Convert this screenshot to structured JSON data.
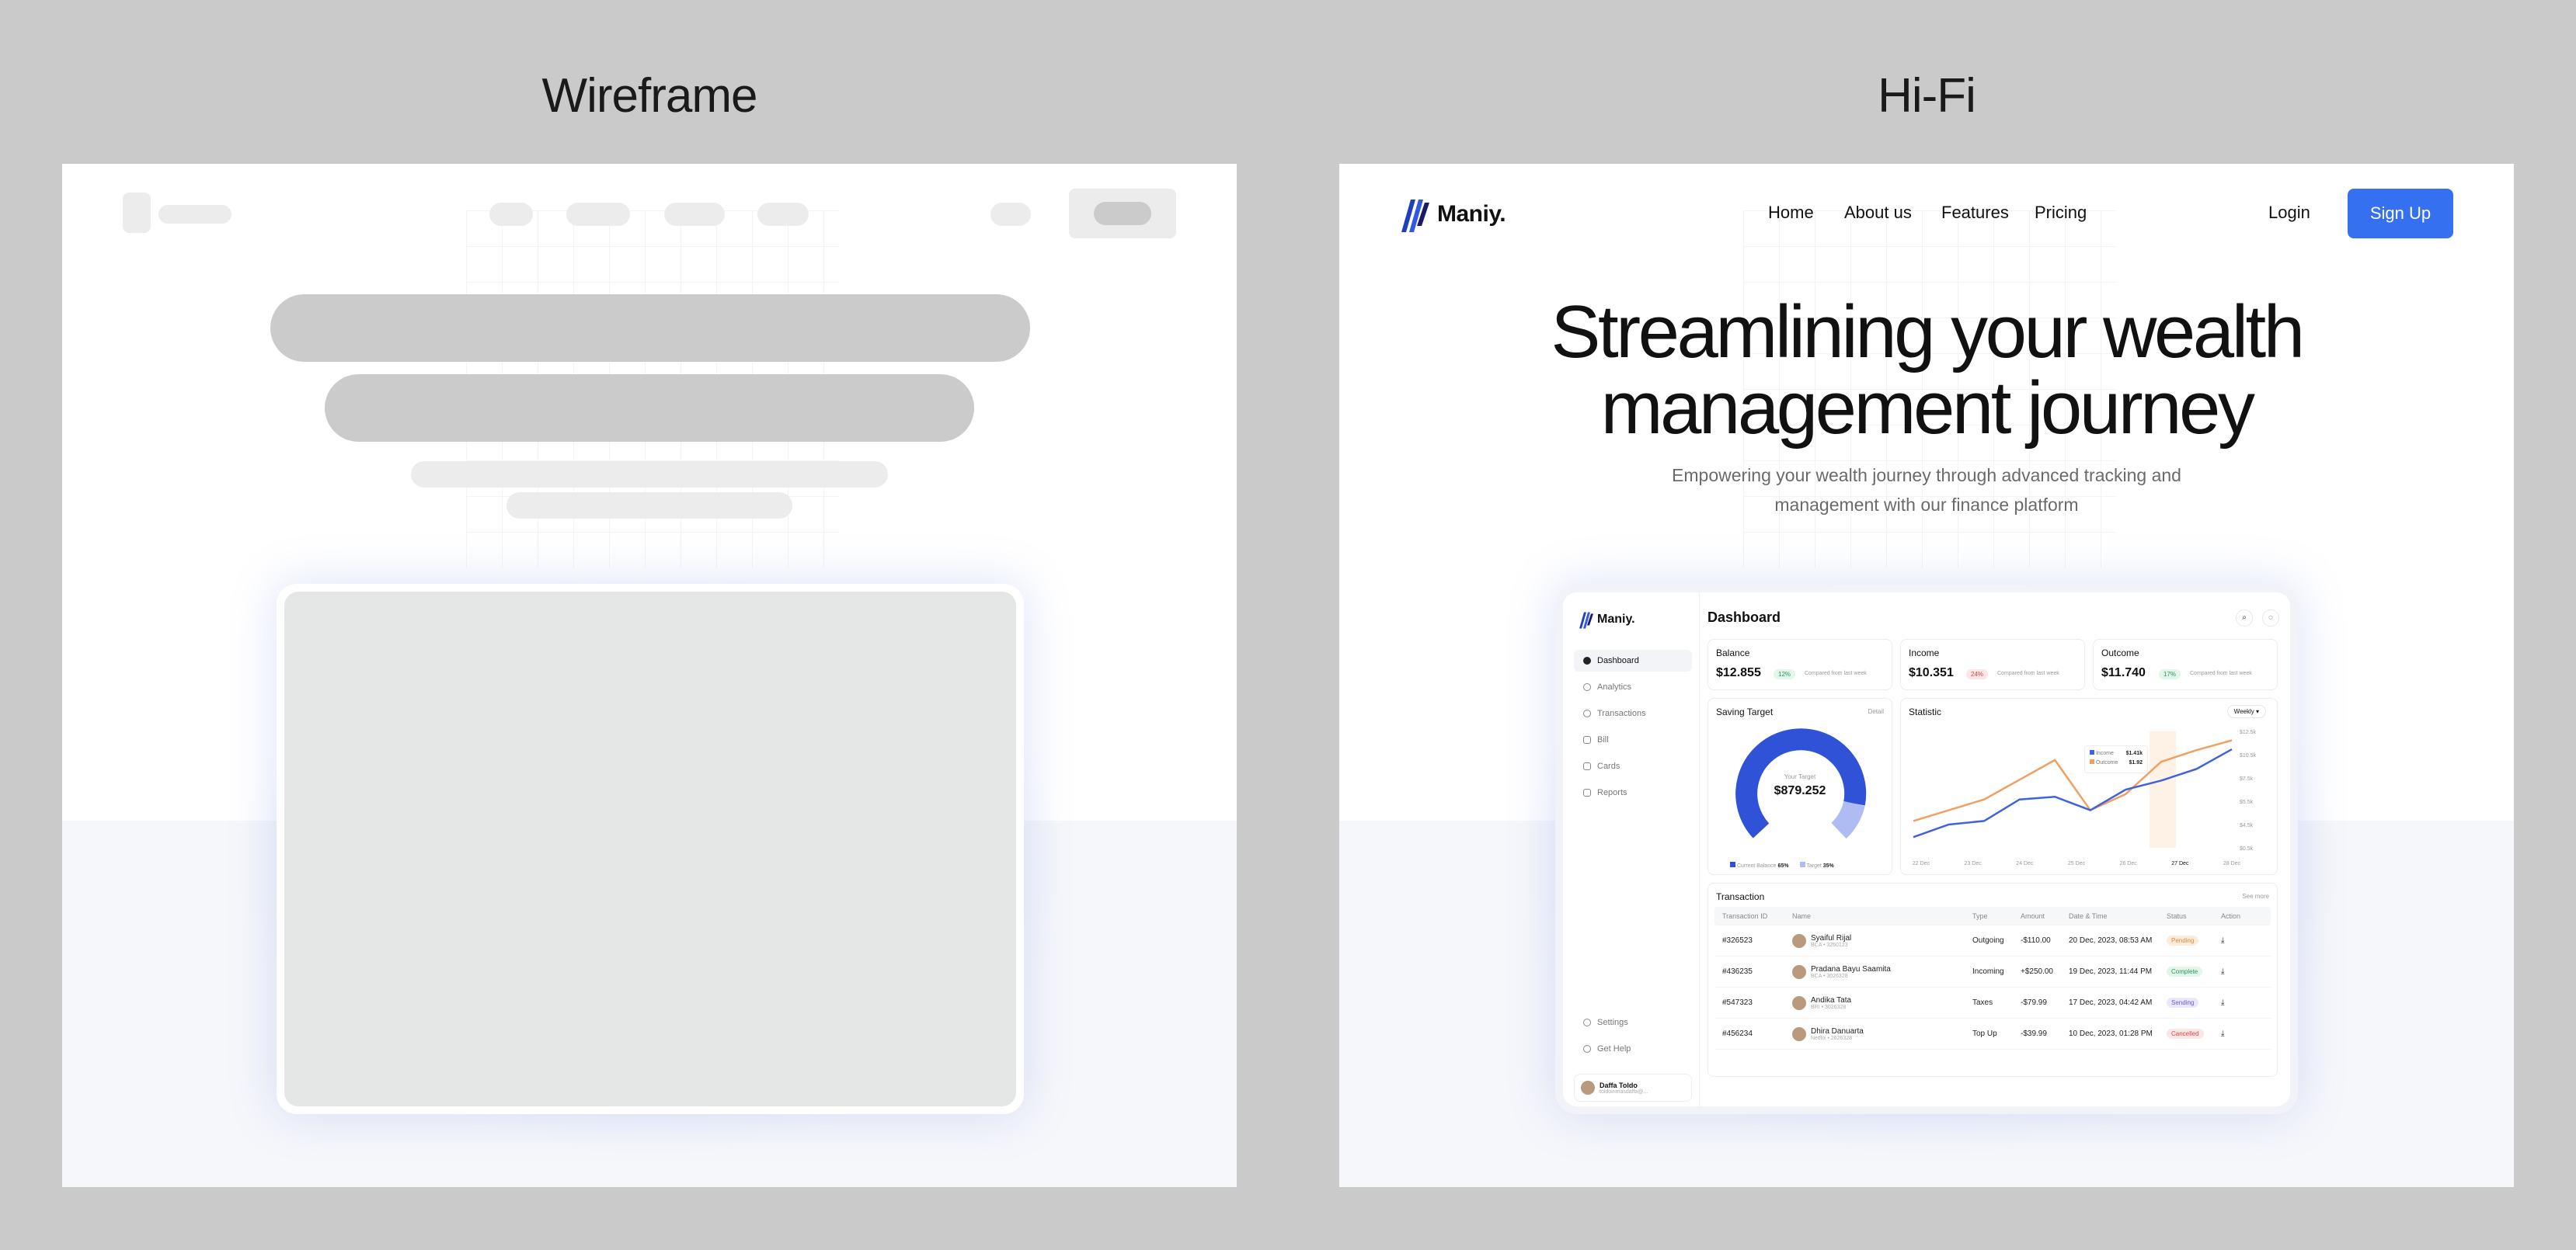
{
  "titles": {
    "wireframe": "Wireframe",
    "hifi": "Hi-Fi"
  },
  "brand": {
    "name": "Maniy.",
    "accent": "#3470f0"
  },
  "nav": {
    "home": "Home",
    "about": "About us",
    "features": "Features",
    "pricing": "Pricing",
    "login": "Login",
    "signup": "Sign Up"
  },
  "hero": {
    "line1": "Streamlining your wealth",
    "line2": "management journey",
    "sub1": "Empowering your wealth journey through advanced tracking and",
    "sub2": "management with our finance platform"
  },
  "dashboard": {
    "title": "Dashboard",
    "sidebar": [
      "Dashboard",
      "Analytics",
      "Transactions",
      "Bill",
      "Cards",
      "Reports"
    ],
    "sidebar_bottom": [
      "Settings",
      "Get Help"
    ],
    "user": {
      "name": "Daffa Toldo",
      "email": "toldoinmasdaffa@..."
    },
    "stats": [
      {
        "label": "Balance",
        "value": "$12.855",
        "change": "12%",
        "note": "Compared from last week",
        "dir": "up"
      },
      {
        "label": "Income",
        "value": "$10.351",
        "change": "24%",
        "note": "Compared from last week",
        "dir": "down"
      },
      {
        "label": "Outcome",
        "value": "$11.740",
        "change": "17%",
        "note": "Compared from last week",
        "dir": "up"
      }
    ],
    "saving": {
      "title": "Saving Target",
      "detail": "Detail",
      "center_label": "Your Target",
      "center_value": "$879.252",
      "legend": [
        {
          "label": "Current Balance",
          "value": "65%"
        },
        {
          "label": "Target",
          "value": "35%"
        }
      ],
      "current_fraction": 0.65
    },
    "statistic": {
      "title": "Statistic",
      "period": "Weekly",
      "tooltip": {
        "income_label": "Income",
        "income_value": "$1.41k",
        "outcome_label": "Outcome",
        "outcome_value": "$1.92"
      }
    },
    "transaction": {
      "title": "Transaction",
      "see_more": "See more",
      "headers": [
        "Transaction ID",
        "Name",
        "Type",
        "Amount",
        "Date & Time",
        "Status",
        "Action"
      ],
      "rows": [
        {
          "id": "#326523",
          "name": "Syaiful Rijal",
          "sub": "BCA • 3260123",
          "type": "Outgoing",
          "amount": "-$110.00",
          "date": "20 Dec, 2023, 08:53 AM",
          "status": "Pending"
        },
        {
          "id": "#436235",
          "name": "Pradana Bayu Saamita",
          "sub": "BCA • 3026328",
          "type": "Incoming",
          "amount": "+$250.00",
          "date": "19 Dec, 2023, 11:44 PM",
          "status": "Complete"
        },
        {
          "id": "#547323",
          "name": "Andika Tata",
          "sub": "BRI • 3026328",
          "type": "Taxes",
          "amount": "-$79.99",
          "date": "17 Dec, 2023, 04:42 AM",
          "status": "Sending"
        },
        {
          "id": "#456234",
          "name": "Dhira Danuarta",
          "sub": "Netflix • 2626328",
          "type": "Top Up",
          "amount": "-$39.99",
          "date": "10 Dec, 2023, 01:28 PM",
          "status": "Cancelled"
        }
      ]
    }
  },
  "chart_data": {
    "type": "line",
    "categories": [
      "22 Dec",
      "23 Dec",
      "24 Dec",
      "25 Dec",
      "26 Dec",
      "27 Dec",
      "28 Dec"
    ],
    "yticks": [
      "$12.5k",
      "$10.5k",
      "$7.5k",
      "$5.5k",
      "$4.5k",
      "$0.5k"
    ],
    "series": [
      {
        "values": [
          3,
          4.2,
          5.4,
          7.6,
          9.8,
          4.2,
          6.0,
          9.6,
          10.9,
          12.0
        ],
        "color": "#f0a060"
      },
      {
        "values": [
          1.2,
          2.6,
          3.0,
          5.4,
          5.7,
          4.2,
          6.5,
          7.5,
          8.8,
          11.0
        ],
        "color": "#3f63dd"
      }
    ],
    "ylim": [
      0,
      13
    ]
  }
}
